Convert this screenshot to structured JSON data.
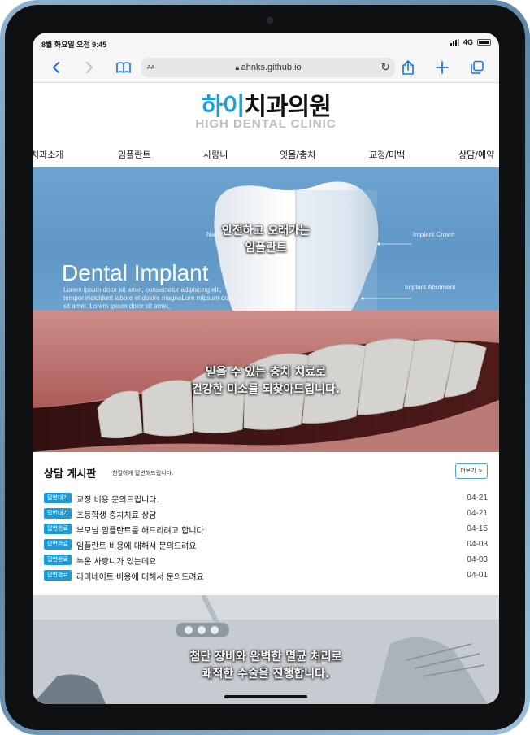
{
  "status": {
    "time": "8월 화요일 오전 9:45",
    "network": "4G"
  },
  "browser": {
    "text_size_label": "AA",
    "url": "ahnks.github.io"
  },
  "site": {
    "logo_hi": "하이",
    "logo_rest": "치과의원",
    "logo_en": "HIGH DENTAL CLINIC",
    "nav": [
      "치과소개",
      "임플란트",
      "사랑니",
      "잇몸/충치",
      "교정/미백",
      "상담/예약"
    ]
  },
  "hero1": {
    "caption_line1": "안전하고 오래가는",
    "caption_line2": "임플란트",
    "title": "Dental Implant",
    "desc": "Lorem ipsum dolor sit amet, consectetur adipiscing elit, tempor incididunt labore et dolore magnaLore mipsum dolor sit amet. Lorem ipsum dolor sit amet,",
    "label_natural": "Natu",
    "label_crown": "Implant Crown",
    "label_abutment": "Implant Abutment"
  },
  "hero2": {
    "caption_line1": "믿을 수 있는 충치 치료로",
    "caption_line2": "건강한 미소를 되찾아드립니다."
  },
  "board": {
    "title": "상담 게시판",
    "subtitle": "친절하게 답변해드립니다.",
    "more_label": "더보기 >",
    "posts": [
      {
        "badge": "답변대기",
        "title": "교정 비용 문의드립니다.",
        "date": "04-21"
      },
      {
        "badge": "답변대기",
        "title": "초등학생 충치치료 상담",
        "date": "04-21"
      },
      {
        "badge": "답변완료",
        "title": "부모님 임플란트를 해드리려고 합니다",
        "date": "04-15"
      },
      {
        "badge": "답변완료",
        "title": "임플란트 비용에 대해서 문의드려요",
        "date": "04-03"
      },
      {
        "badge": "답변완료",
        "title": "누운 사랑니가 있는데요",
        "date": "04-03"
      },
      {
        "badge": "답변완료",
        "title": "라미네이트 비용에 대해서 문의드려요",
        "date": "04-01"
      }
    ]
  },
  "hero3": {
    "caption_line1": "첨단 장비와 완벽한 멸균 처리로",
    "caption_line2": "쾌적한 수술을 진행합니다."
  },
  "colors": {
    "accent": "#1b9bd8",
    "browser_blue": "#1a73e8",
    "device_frame": "#7ea8c6"
  }
}
